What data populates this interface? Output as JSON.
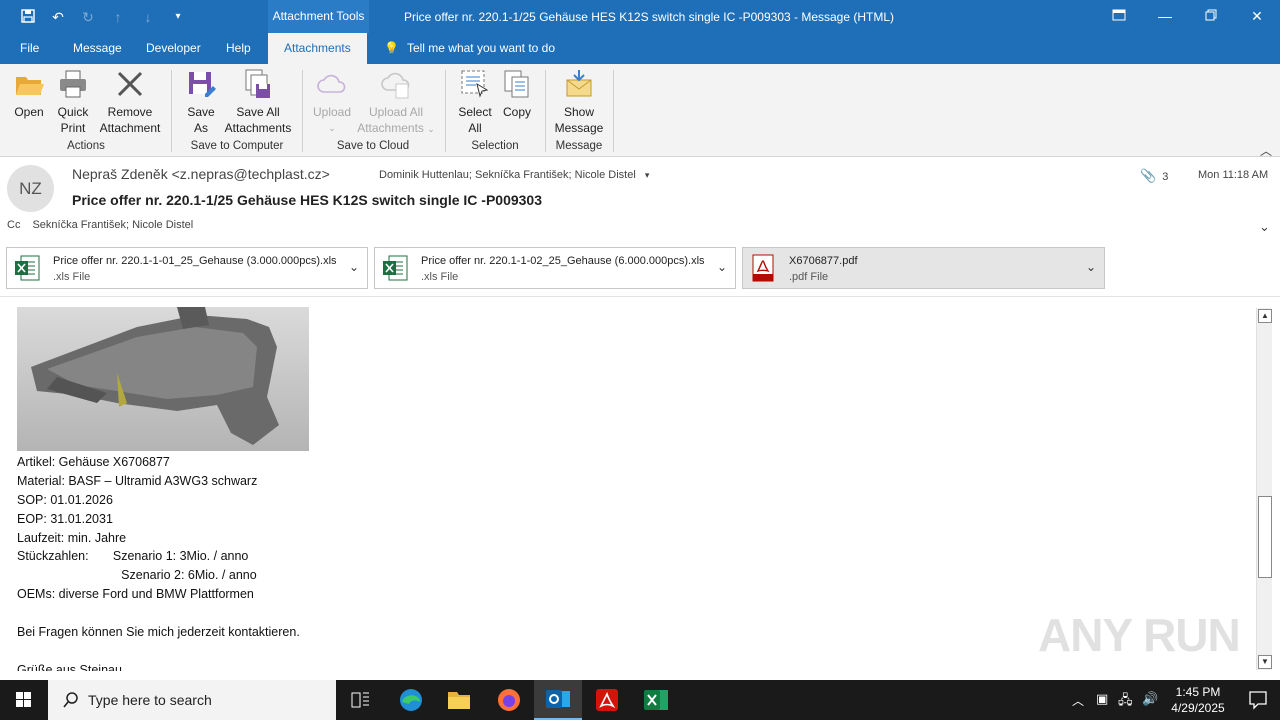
{
  "window": {
    "title": "Price offer nr. 220.1-1/25 Gehäuse HES K12S switch single IC -P009303  -  Message (HTML)",
    "context_tab": "Attachment Tools"
  },
  "tabs": [
    "File",
    "Message",
    "Developer",
    "Help",
    "Attachments"
  ],
  "active_tab": "Attachments",
  "tell_me": "Tell me what you want to do",
  "ribbon": {
    "open": "Open",
    "quick_print_1": "Quick",
    "quick_print_2": "Print",
    "remove_1": "Remove",
    "remove_2": "Attachment",
    "group_actions": "Actions",
    "save_as_1": "Save",
    "save_as_2": "As",
    "save_all_1": "Save All",
    "save_all_2": "Attachments",
    "group_save_computer": "Save to Computer",
    "upload": "Upload",
    "upload_all_1": "Upload All",
    "upload_all_2": "Attachments",
    "group_save_cloud": "Save to Cloud",
    "select_all_1": "Select",
    "select_all_2": "All",
    "copy": "Copy",
    "group_selection": "Selection",
    "show_message_1": "Show",
    "show_message_2": "Message",
    "group_message": "Message"
  },
  "message": {
    "avatar_initials": "NZ",
    "sender": "Nepraš Zdeněk <z.nepras@techplast.cz>",
    "to": "Dominik Huttenlau; Sekníčka František; Nicole Distel",
    "subject": "Price offer nr. 220.1-1/25 Gehäuse HES K12S switch single IC -P009303",
    "attachment_count": "3",
    "date": "Mon 11:18 AM",
    "cc_label": "Cc",
    "cc": "Sekníčka František; Nicole Distel"
  },
  "attachments": [
    {
      "name": "Price offer nr. 220.1-1-01_25_Gehause (3.000.000pcs).xls",
      "type": ".xls File"
    },
    {
      "name": "Price offer nr. 220.1-1-02_25_Gehause (6.000.000pcs).xls",
      "type": ".xls File"
    },
    {
      "name": "X6706877.pdf",
      "type": ".pdf File"
    }
  ],
  "body_lines": [
    "Artikel: Gehäuse X6706877",
    "Material: BASF – Ultramid A3WG3 schwarz",
    "SOP: 01.01.2026",
    "EOP: 31.01.2031",
    "Laufzeit: min. Jahre",
    "Stückzahlen:       Szenario 1: 3Mio. / anno",
    "                              Szenario 2: 6Mio. / anno",
    "OEMs: diverse Ford und BMW Plattformen",
    "",
    "Bei Fragen können Sie mich jederzeit kontaktieren.",
    "",
    "Grüße aus Steinau"
  ],
  "watermark": "ANY RUN",
  "taskbar": {
    "search_placeholder": "Type here to search",
    "time": "1:45 PM",
    "date": "4/29/2025"
  }
}
